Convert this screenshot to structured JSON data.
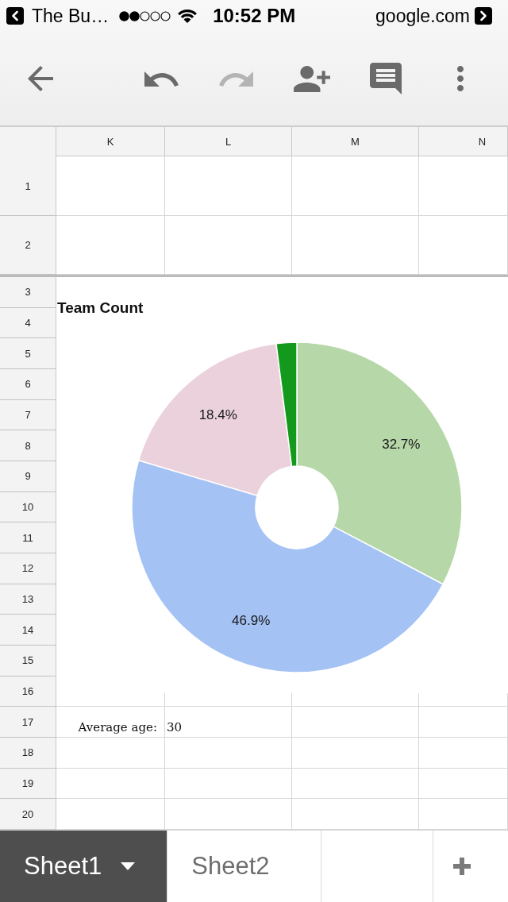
{
  "status_bar": {
    "back_label": "The Bu…",
    "time": "10:52 PM",
    "site": "google.com"
  },
  "toolbar": [
    {
      "kind": "back",
      "disabled": false
    },
    {
      "kind": "undo",
      "disabled": false
    },
    {
      "kind": "redo",
      "disabled": true
    },
    {
      "kind": "add_person",
      "disabled": false
    },
    {
      "kind": "comments",
      "disabled": false
    },
    {
      "kind": "more",
      "disabled": false
    }
  ],
  "sheet": {
    "columns": [
      "K",
      "L",
      "M",
      "N"
    ],
    "frozen_rows": [
      {
        "number": "1"
      },
      {
        "number": "2"
      }
    ],
    "rows": [
      {
        "number": "3"
      },
      {
        "number": "4"
      },
      {
        "number": "5"
      },
      {
        "number": "6"
      },
      {
        "number": "7"
      },
      {
        "number": "8"
      },
      {
        "number": "9"
      },
      {
        "number": "10"
      },
      {
        "number": "11"
      },
      {
        "number": "12"
      },
      {
        "number": "13"
      },
      {
        "number": "14"
      },
      {
        "number": "15"
      },
      {
        "number": "16"
      },
      {
        "number": "17",
        "cells": [
          "Average age:",
          "30"
        ]
      },
      {
        "number": "18"
      },
      {
        "number": "19"
      },
      {
        "number": "20"
      }
    ],
    "chart": {
      "chart_data": {
        "type": "donut",
        "title": "Team Count",
        "values": [
          32.7,
          46.9,
          18.4,
          2.0
        ],
        "colors": [
          "#b6d7a8",
          "#a4c2f4",
          "#ead1dc",
          "#139a1c"
        ],
        "value_labels": [
          "32.7%",
          "46.9%",
          "18.4%",
          null
        ]
      }
    }
  },
  "sheet_tabs": [
    {
      "label": "Sheet1",
      "selected": true
    },
    {
      "label": "Sheet2",
      "selected": false
    }
  ]
}
